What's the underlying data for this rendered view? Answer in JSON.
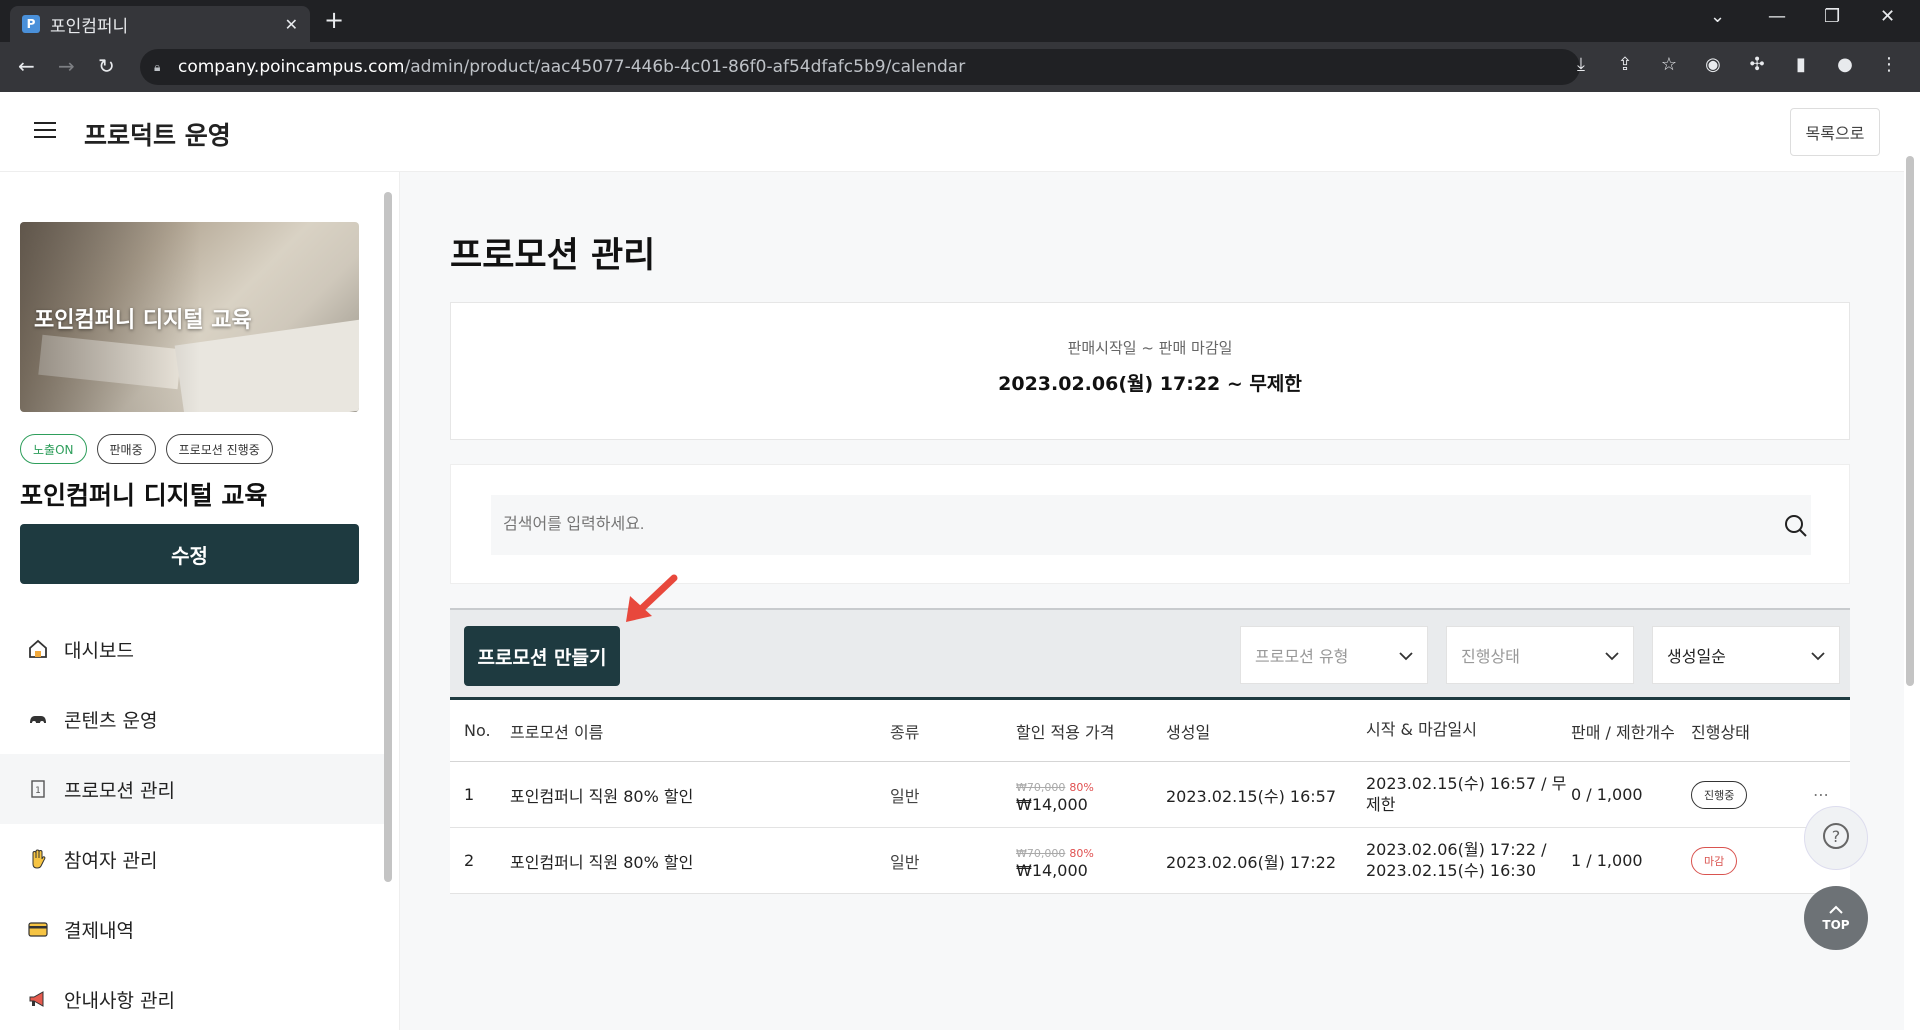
{
  "browser": {
    "tab_title": "포인컴퍼니",
    "favicon_letter": "P",
    "url_domain": "company.poincampus.com",
    "url_path": "/admin/product/aac45077-446b-4c01-86f0-af54dfafc5b9/calendar"
  },
  "header": {
    "title": "프로덕트 운영",
    "back_label": "목록으로"
  },
  "sidebar": {
    "thumbnail_text": "포인컴퍼니 디지털 교육",
    "badges": [
      "노출ON",
      "판매중",
      "프로모션 진행중"
    ],
    "product_name": "포인컴퍼니 디지털 교육",
    "edit_label": "수정",
    "items": [
      {
        "label": "대시보드",
        "icon": "home-icon"
      },
      {
        "label": "콘텐츠 운영",
        "icon": "content-icon"
      },
      {
        "label": "프로모션 관리",
        "icon": "promotion-icon"
      },
      {
        "label": "참여자 관리",
        "icon": "hand-icon"
      },
      {
        "label": "결제내역",
        "icon": "card-icon"
      },
      {
        "label": "안내사항 관리",
        "icon": "megaphone-icon"
      }
    ]
  },
  "main": {
    "title": "프로모션 관리",
    "period_label": "판매시작일 ~ 판매 마감일",
    "period_value": "2023.02.06(월) 17:22 ~ 무제한",
    "search_placeholder": "검색어를 입력하세요.",
    "create_label": "프로모션 만들기",
    "filters": [
      "프로모션 유형",
      "진행상태",
      "생성일순"
    ],
    "columns": [
      "No.",
      "프로모션 이름",
      "종류",
      "할인 적용 가격",
      "생성일",
      "시작 & 마감일시",
      "판매 / 제한개수",
      "진행상태"
    ],
    "rows": [
      {
        "no": "1",
        "name": "포인컴퍼니 직원 80% 할인",
        "type": "일반",
        "original_price": "₩70,000",
        "discount": "80%",
        "price": "₩14,000",
        "created": "2023.02.15(수) 16:57",
        "period": "2023.02.15(수) 16:57 / 무제한",
        "sales": "0 / 1,000",
        "status": "진행중"
      },
      {
        "no": "2",
        "name": "포인컴퍼니 직원 80% 할인",
        "type": "일반",
        "original_price": "₩70,000",
        "discount": "80%",
        "price": "₩14,000",
        "created": "2023.02.06(월) 17:22",
        "period": "2023.02.06(월) 17:22 / 2023.02.15(수) 16:30",
        "sales": "1 / 1,000",
        "status": "마감"
      }
    ],
    "top_label": "TOP"
  },
  "colors": {
    "primary": "#1e3a40",
    "status_active": "#333333",
    "status_closed": "#d9534f",
    "accent_arrow": "#e8483c"
  }
}
